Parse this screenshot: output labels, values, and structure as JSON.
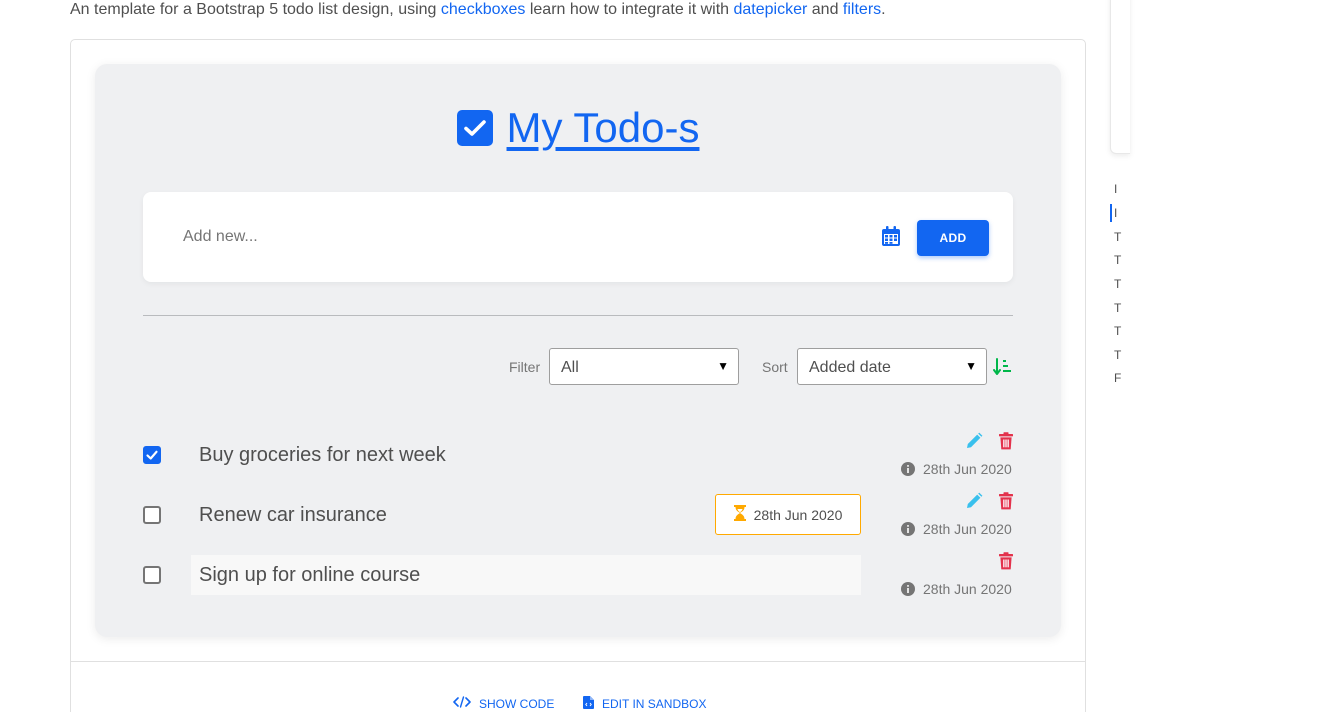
{
  "intro": {
    "prefix": "An template for a Bootstrap 5 todo list design, using ",
    "link1": "checkboxes",
    "mid1": " learn how to integrate it with ",
    "link2": "datepicker",
    "mid2": " and ",
    "link3": "filters",
    "suffix": "."
  },
  "title": "My Todo-s",
  "add": {
    "placeholder": "Add new...",
    "button_label": "ADD"
  },
  "controls": {
    "filter_label": "Filter",
    "filter_value": "All",
    "sort_label": "Sort",
    "sort_value": "Added date"
  },
  "todos": [
    {
      "text": "Buy groceries for next week",
      "checked": true,
      "due": "",
      "created": "28th Jun 2020"
    },
    {
      "text": "Renew car insurance",
      "checked": false,
      "due": "28th Jun 2020",
      "created": "28th Jun 2020"
    },
    {
      "text": "Sign up for online course",
      "checked": false,
      "due": "",
      "created": "28th Jun 2020"
    }
  ],
  "footer": {
    "show_code": "SHOW CODE",
    "edit_sandbox": "EDIT IN SANDBOX"
  },
  "toc": [
    "I",
    "I",
    "T",
    "T",
    "T",
    "T",
    "T",
    "T",
    "F"
  ],
  "colors": {
    "primary": "#1266f1",
    "danger": "#e3324c",
    "info": "#39c0ed",
    "warning": "#ffa900",
    "success": "#00b74a",
    "panel_bg": "#eff0f2"
  }
}
